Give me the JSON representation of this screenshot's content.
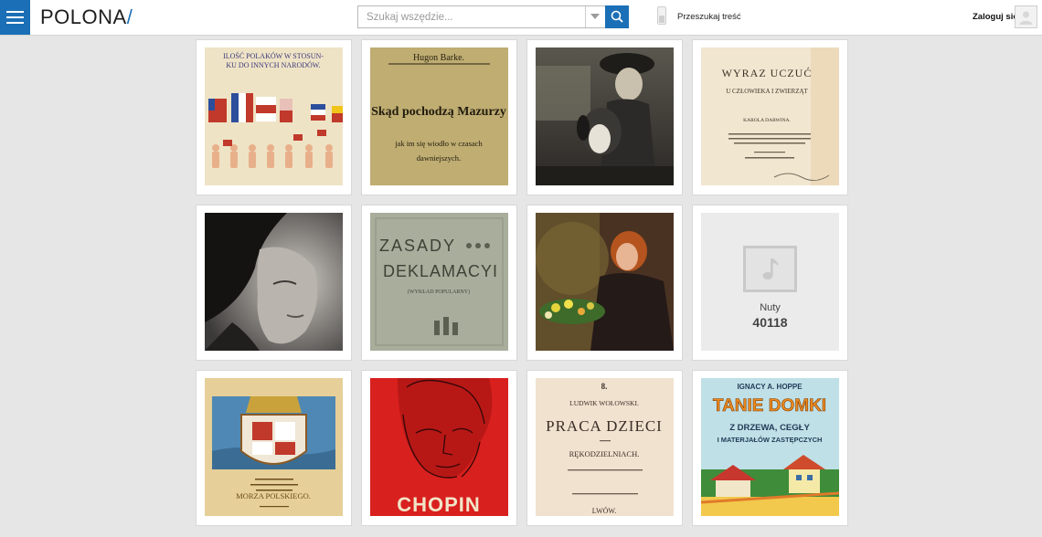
{
  "header": {
    "logo_text": "POLONA",
    "logo_slash": "/",
    "search": {
      "placeholder": "Szukaj wszędzie...",
      "value": ""
    },
    "fulltext_toggle_label": "Przeszukaj treść",
    "login_label": "Zaloguj się"
  },
  "colors": {
    "brand_blue": "#1b6fb6",
    "background": "#e6e6e6"
  },
  "icons": {
    "menu": "hamburger-icon",
    "search": "magnifier-icon",
    "dropdown": "chevron-down-icon",
    "user": "user-avatar-icon",
    "music": "music-note-icon"
  },
  "grid": {
    "items": [
      {
        "kind": "image",
        "subject": "poster",
        "lines": [
          "ILOŚĆ POLAKÓW W STOSUN-",
          "KU DO INNYCH NARODÓW."
        ]
      },
      {
        "kind": "image",
        "subject": "book-cover",
        "lines": [
          "Hugon Barke.",
          "Skąd pochodzą Mazurzy",
          "jak im się wiodło w czasach",
          "dawniejszych."
        ]
      },
      {
        "kind": "image",
        "subject": "painting-child-with-dog",
        "lines": []
      },
      {
        "kind": "image",
        "subject": "book-title-page",
        "lines": [
          "WYRAZ UCZUĆ",
          "U CZŁOWIEKA I ZWIERZĄT",
          "KAROLA DARWINA."
        ]
      },
      {
        "kind": "image",
        "subject": "portrait-photograph",
        "lines": []
      },
      {
        "kind": "image",
        "subject": "book-cover",
        "lines": [
          "ZASADY",
          "DEKLAMACYI",
          "(WYKŁAD POPULARNY)"
        ]
      },
      {
        "kind": "image",
        "subject": "painting-woman-with-flowers",
        "lines": []
      },
      {
        "kind": "placeholder",
        "label": "Nuty",
        "count": "40118"
      },
      {
        "kind": "image",
        "subject": "poster-coat-of-arms",
        "lines": [
          "MORZA POLSKIEGO."
        ]
      },
      {
        "kind": "image",
        "subject": "poster",
        "lines": [
          "CHOPIN"
        ]
      },
      {
        "kind": "image",
        "subject": "book-title-page",
        "lines": [
          "8.",
          "LUDWIK WOŁOWSKI.",
          "PRACA DZIECI",
          "RĘKODZIELNIACH.",
          "LWÓW."
        ]
      },
      {
        "kind": "image",
        "subject": "book-cover",
        "lines": [
          "IGNACY A. HOPPE",
          "TANIE DOMKI",
          "Z DRZEWA, CEGŁY",
          "I MATERJAŁÓW ZASTĘPCZYCH"
        ]
      }
    ]
  }
}
